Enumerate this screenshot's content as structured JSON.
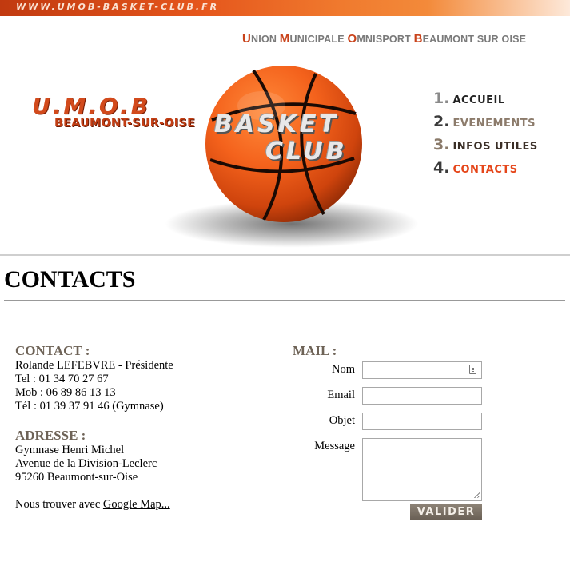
{
  "site_url": "WWW.UMOB-BASKET-CLUB.FR",
  "header": {
    "union_words": [
      {
        "cap": "U",
        "rest": "NION"
      },
      {
        "cap": "M",
        "rest": "UNICIPALE"
      },
      {
        "cap": "O",
        "rest": "MNISPORT"
      },
      {
        "cap": "B",
        "rest": "EAUMONT SUR OISE"
      }
    ],
    "logo_title": "U.M.O.B",
    "logo_city": "BEAUMONT-SUR-OISE",
    "ball_line1": "BASKET",
    "ball_line2": "CLUB"
  },
  "nav": {
    "items": [
      {
        "num": "1.",
        "label": "ACCUEIL",
        "num_color": "#8a8a8a",
        "label_color": "#222222"
      },
      {
        "num": "2.",
        "label": "EVENEMENTS",
        "num_color": "#3a3a3a",
        "label_color": "#8c7b6b"
      },
      {
        "num": "3.",
        "label": "INFOS UTILES",
        "num_color": "#8a7a6a",
        "label_color": "#3a2e26"
      },
      {
        "num": "4.",
        "label": "CONTACTS",
        "num_color": "#3a3a3a",
        "label_color": "#e5461a"
      }
    ]
  },
  "page": {
    "title": "CONTACTS"
  },
  "contact": {
    "heading": "CONTACT :",
    "lines": [
      "Rolande LEFEBVRE - Présidente",
      "Tel : 01 34 70 27 67",
      "Mob : 06 89 86 13 13",
      "Tél : 01 39 37 91 46 (Gymnase)"
    ]
  },
  "address": {
    "heading": "ADRESSE :",
    "lines": [
      "Gymnase Henri Michel",
      "Avenue de la Division-Leclerc",
      "95260 Beaumont-sur-Oise"
    ],
    "map_prefix": "Nous trouver avec ",
    "map_link": "Google Map..."
  },
  "mail_form": {
    "heading": "MAIL :",
    "name_label": "Nom",
    "name_value": "",
    "email_label": "Email",
    "email_value": "",
    "subject_label": "Objet",
    "subject_value": "",
    "message_label": "Message",
    "message_value": "",
    "submit_label": "VALIDER"
  }
}
